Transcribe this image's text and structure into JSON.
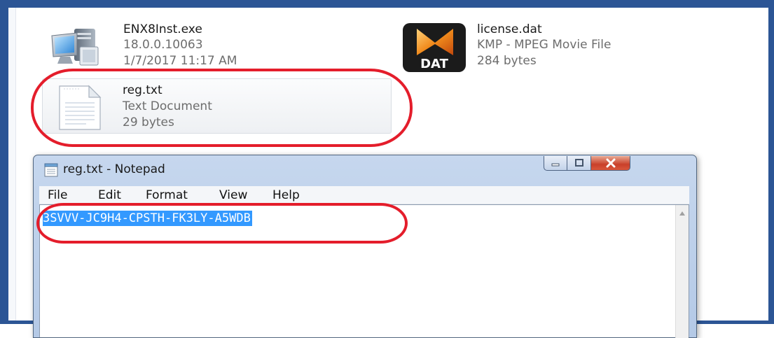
{
  "colors": {
    "frame": "#2c5595",
    "annotation": "#e41d2b",
    "selection": "#3399ff"
  },
  "explorer": {
    "files": [
      {
        "name": "ENX8Inst.exe",
        "line2": "18.0.0.10063",
        "line3": "1/7/2017 11:17 AM",
        "icon": "installer-computer-icon"
      },
      {
        "name": "license.dat",
        "line2": "KMP - MPEG Movie File",
        "line3": "284 bytes",
        "icon": "kmplayer-dat-icon",
        "icon_label": "DAT"
      },
      {
        "name": "reg.txt",
        "line2": "Text Document",
        "line3": "29 bytes",
        "icon": "text-document-icon",
        "selected": true
      }
    ]
  },
  "notepad": {
    "title": "reg.txt - Notepad",
    "menu": [
      "File",
      "Edit",
      "Format",
      "View",
      "Help"
    ],
    "content": "3SVVV-JC9H4-CPSTH-FK3LY-A5WDB",
    "content_selected": true,
    "controls": [
      "minimize-icon",
      "maximize-icon",
      "close-icon"
    ]
  }
}
